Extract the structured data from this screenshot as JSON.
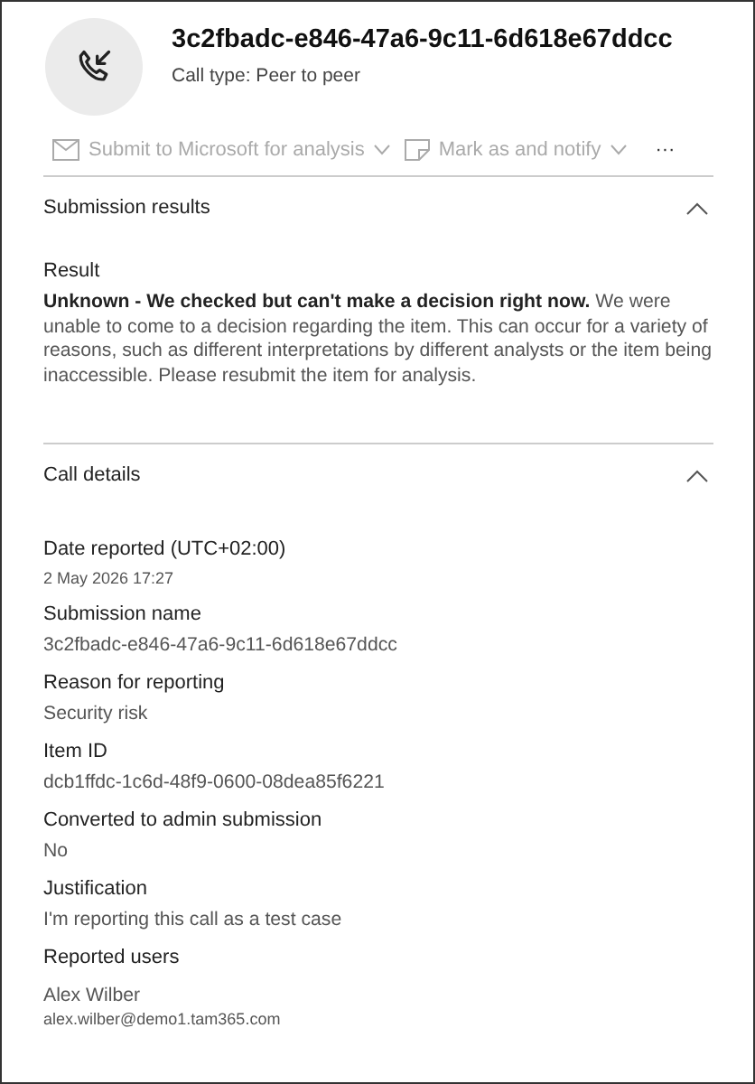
{
  "header": {
    "title": "3c2fbadc-e846-47a6-9c11-6d618e67ddcc",
    "subtitle": "Call type: Peer to peer"
  },
  "toolbar": [
    {
      "kind": "submit",
      "label": "Submit to Microsoft for analysis",
      "disabled": true
    },
    {
      "kind": "mark",
      "label": "Mark as and notify",
      "disabled": true
    },
    {
      "kind": "more",
      "label": "···"
    }
  ],
  "sections": [
    {
      "title": "Submission results",
      "expanded": true,
      "fields": [
        {
          "kind": "paragraph",
          "label": "Result",
          "value": "**Unknown - We checked but can't make a decision right now.** We were unable to come to a decision regarding the item. This can occur for a variety of reasons, such as different interpretations by different analysts or the item being inaccessible. Please resubmit the item for analysis."
        }
      ]
    },
    {
      "title": "Call details",
      "expanded": true,
      "fields": [
        {
          "kind": "small",
          "label": "Date reported (UTC+02:00)",
          "value": "2 May 2026 17:27"
        },
        {
          "kind": "text",
          "label": "Submission name",
          "value": "3c2fbadc-e846-47a6-9c11-6d618e67ddcc"
        },
        {
          "kind": "text",
          "label": "Reason for reporting",
          "value": "Security risk"
        },
        {
          "kind": "text",
          "label": "Item ID",
          "value": "dcb1ffdc-1c6d-48f9-0600-08dea85f6221"
        },
        {
          "kind": "text",
          "label": "Converted to admin submission",
          "value": "No"
        },
        {
          "kind": "text",
          "label": "Justification",
          "value": "I'm reporting this call as a test case"
        },
        {
          "kind": "user",
          "label": "Reported users",
          "value": "Alex Wilber",
          "email": "alex.wilber@demo1.tam365.com"
        }
      ]
    }
  ]
}
